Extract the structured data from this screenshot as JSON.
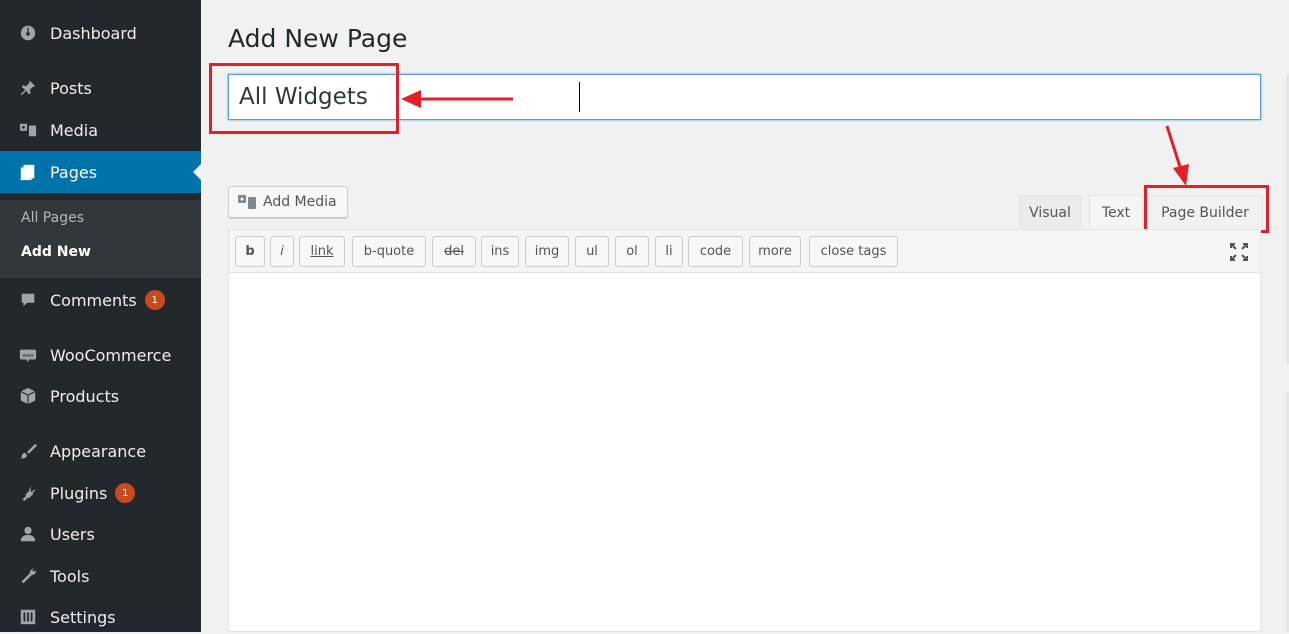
{
  "sidebar": {
    "items": [
      {
        "label": "Dashboard",
        "icon": "dashboard-icon"
      },
      {
        "label": "Posts",
        "icon": "pin-icon"
      },
      {
        "label": "Media",
        "icon": "media-icon"
      },
      {
        "label": "Pages",
        "icon": "pages-icon"
      },
      {
        "label": "Comments",
        "icon": "comment-icon",
        "badge": "1"
      },
      {
        "label": "WooCommerce",
        "icon": "woo-icon"
      },
      {
        "label": "Products",
        "icon": "box-icon"
      },
      {
        "label": "Appearance",
        "icon": "brush-icon"
      },
      {
        "label": "Plugins",
        "icon": "plug-icon",
        "badge": "1"
      },
      {
        "label": "Users",
        "icon": "user-icon"
      },
      {
        "label": "Tools",
        "icon": "wrench-icon"
      },
      {
        "label": "Settings",
        "icon": "settings-icon"
      }
    ],
    "submenu": [
      {
        "label": "All Pages"
      },
      {
        "label": "Add New"
      }
    ]
  },
  "main": {
    "title": "Add New Page",
    "post_title_value": "All Widgets",
    "add_media_label": "Add Media",
    "tabs": [
      {
        "label": "Visual"
      },
      {
        "label": "Text"
      },
      {
        "label": "Page Builder"
      }
    ],
    "quicktags": [
      "b",
      "i",
      "link",
      "b-quote",
      "del",
      "ins",
      "img",
      "ul",
      "ol",
      "li",
      "code",
      "more",
      "close tags"
    ]
  },
  "colors": {
    "sidebar_bg": "#23282d",
    "active_bg": "#0073aa",
    "annotation_red": "#e3202a",
    "badge": "#ca4a1f"
  }
}
